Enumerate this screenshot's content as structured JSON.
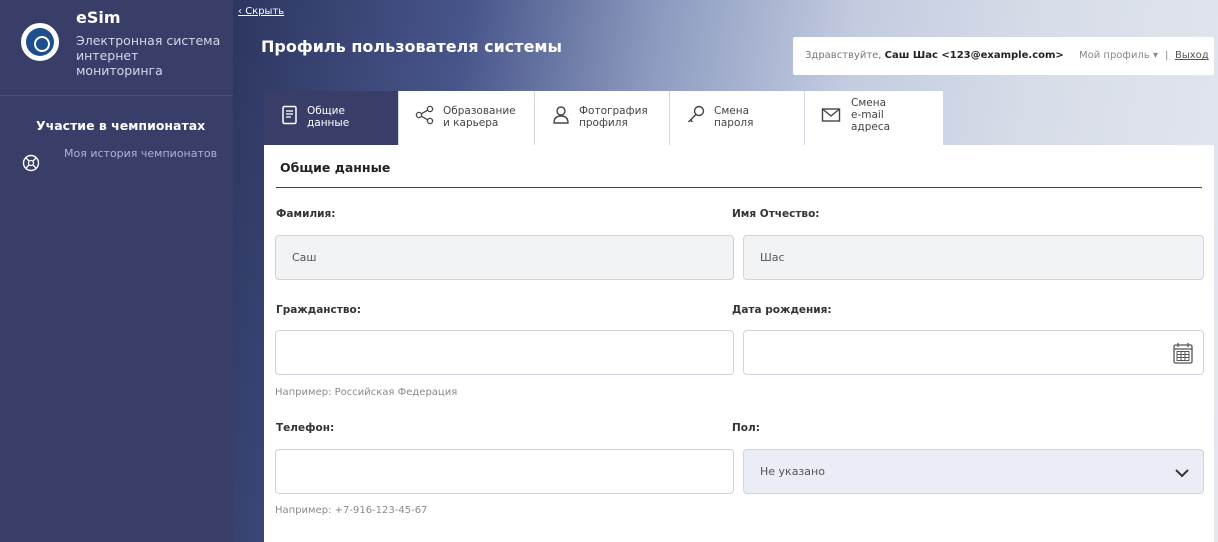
{
  "sidebar": {
    "brand_title": "eSim",
    "brand_subtitle": "Электронная система интернет мониторинга",
    "section_heading": "Участие в чемпионатах",
    "link_history": "Моя история чемпионатов"
  },
  "header": {
    "hide_link": "Скрыть",
    "page_title": "Профиль пользователя системы"
  },
  "userbar": {
    "greeting_prefix": "Здравствуйте, ",
    "user_name": "Саш Шас <123@example.com>",
    "my_profile": "Мой профиль ▾",
    "separator": "|",
    "logout": "Выход"
  },
  "tabs": [
    {
      "label": "Общие\nданные",
      "icon": "document-icon",
      "active": true
    },
    {
      "label": "Образование\nи карьера",
      "icon": "share-icon",
      "active": false
    },
    {
      "label": "Фотография\nпрофиля",
      "icon": "user-photo-icon",
      "active": false
    },
    {
      "label": "Смена\nпароля",
      "icon": "key-icon",
      "active": false
    },
    {
      "label": "Смена\ne-mail\nадреса",
      "icon": "envelope-icon",
      "active": false
    }
  ],
  "form": {
    "section_title": "Общие данные",
    "surname_label": "Фамилия:",
    "surname_value": "Саш",
    "name_label": "Имя Отчество:",
    "name_value": "Шас",
    "citizenship_label": "Гражданство:",
    "citizenship_value": "",
    "citizenship_hint": "Например: Российская Федерация",
    "birthdate_label": "Дата рождения:",
    "birthdate_value": "",
    "phone_label": "Телефон:",
    "phone_value": "",
    "phone_hint": "Например: +7-916-123-45-67",
    "gender_label": "Пол:",
    "gender_value": "Не указано"
  },
  "colors": {
    "sidebar": "#383e67",
    "active_tab": "#383e67",
    "select_bg": "#eaedf5"
  }
}
